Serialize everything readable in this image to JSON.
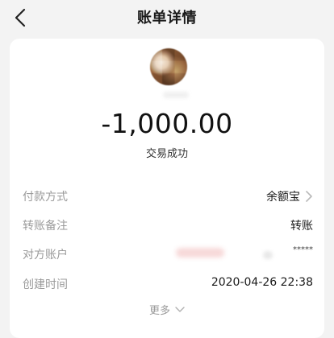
{
  "navbar": {
    "title": "账单详情",
    "back_icon": "chevron-left-icon"
  },
  "transaction": {
    "amount": "-1,000.00",
    "status": "交易成功"
  },
  "details": {
    "payment_method": {
      "label": "付款方式",
      "value": "余额宝",
      "icon": "chevron-right-icon"
    },
    "transfer_note": {
      "label": "转账备注",
      "value": "转账"
    },
    "counterparty_account": {
      "label": "对方账户",
      "value": "*****"
    },
    "created_time": {
      "label": "创建时间",
      "value": "2020-04-26 22:38"
    }
  },
  "more": {
    "label": "更多",
    "icon": "chevron-down-icon"
  },
  "colors": {
    "background": "#f3f3f3",
    "card": "#ffffff",
    "label": "#9a9a9a",
    "value": "#1a1a1a"
  }
}
